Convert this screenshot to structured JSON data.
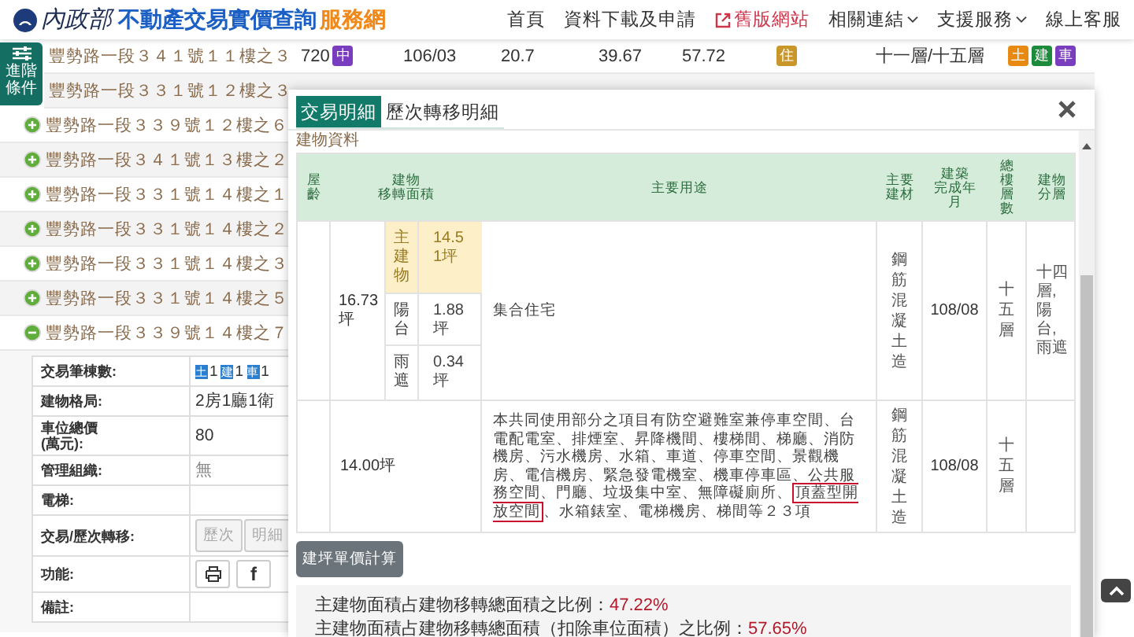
{
  "header": {
    "ministry": "內政部",
    "title": "不動產交易實價查詢",
    "title_accent": "服務網",
    "nav": [
      {
        "label": "首頁",
        "kind": "link"
      },
      {
        "label": "資料下載及申請",
        "kind": "link"
      },
      {
        "label": "舊版網站",
        "kind": "external"
      },
      {
        "label": "相關連結",
        "kind": "dropdown"
      },
      {
        "label": "支援服務",
        "kind": "dropdown"
      },
      {
        "label": "線上客服",
        "kind": "link"
      }
    ]
  },
  "filter_button": {
    "label": "進階條件"
  },
  "results": [
    {
      "address": "豐勢路一段３４１號１１樓之３",
      "cells": [
        [
          {
            "kind": "text",
            "text": "720"
          },
          {
            "kind": "badge",
            "text": "中",
            "color": "#7b3dbf"
          }
        ],
        [
          {
            "kind": "text",
            "text": "106/03"
          }
        ],
        [
          {
            "kind": "text",
            "text": "20.7"
          }
        ],
        [
          {
            "kind": "text",
            "text": "39.67"
          }
        ],
        [
          {
            "kind": "text",
            "text": "57.72"
          }
        ],
        [
          {
            "kind": "badge",
            "text": "住",
            "color": "#c9962a"
          }
        ],
        [
          {
            "kind": "text",
            "text": "十一層/十五層"
          }
        ],
        [
          {
            "kind": "badge",
            "text": "土",
            "color": "#e88a12"
          },
          {
            "kind": "badge",
            "text": "建",
            "color": "#1e8a3c"
          },
          {
            "kind": "badge",
            "text": "車",
            "color": "#7b3dbf"
          }
        ]
      ]
    },
    {
      "address": "豐勢路一段３３１號１２樓之３"
    },
    {
      "address": "豐勢路一段３３９號１２樓之６",
      "expanded": false
    },
    {
      "address": "豐勢路一段３４１號１３樓之２",
      "expanded": false
    },
    {
      "address": "豐勢路一段３３１號１４樓之１",
      "expanded": false
    },
    {
      "address": "豐勢路一段３３１號１４樓之２",
      "expanded": false
    },
    {
      "address": "豐勢路一段３３１號１４樓之３",
      "expanded": false
    },
    {
      "address": "豐勢路一段３３１號１４樓之５",
      "expanded": false
    },
    {
      "address": "豐勢路一段３３９號１４樓之７",
      "expanded": true,
      "detail": [
        {
          "label": [
            "交易筆棟數:"
          ],
          "kind": "counts",
          "counts": [
            {
              "label": "土",
              "count": "1"
            },
            {
              "label": "建",
              "count": "1"
            },
            {
              "label": "車",
              "count": "1"
            }
          ]
        },
        {
          "label": [
            "建物格局:"
          ],
          "kind": "text",
          "value": "2房1廳1衛"
        },
        {
          "label": [
            "車位總價",
            "(萬元):"
          ],
          "kind": "text",
          "value": "80"
        },
        {
          "label": [
            "管理組織:"
          ],
          "kind": "muted",
          "value": "無"
        },
        {
          "label": [
            "電梯:"
          ],
          "kind": "empty"
        },
        {
          "label": [
            "交易/歷次轉移:"
          ],
          "kind": "buttons",
          "buttons": [
            {
              "label": "歷次",
              "disabled": true
            },
            {
              "label": "明細",
              "disabled": true
            }
          ]
        },
        {
          "label": [
            "功能:"
          ],
          "kind": "icons",
          "icons": [
            {
              "kind": "print"
            },
            {
              "kind": "facebook",
              "text": "f"
            }
          ]
        },
        {
          "label": [
            "備註:"
          ],
          "kind": "empty"
        }
      ]
    }
  ],
  "modal": {
    "tabs": [
      {
        "label": "交易明細",
        "selected": true
      },
      {
        "label": "歷次轉移明細",
        "selected": false
      }
    ],
    "section_title": "建物資料",
    "columns": [
      {
        "lines": [
          "屋",
          "齡"
        ]
      },
      {
        "lines": [
          "建物",
          "移轉面積"
        ]
      },
      {
        "lines": [
          "主要用途"
        ]
      },
      {
        "lines": [
          "主要",
          "建材"
        ]
      },
      {
        "lines": [
          "建築",
          "完成年",
          "月"
        ]
      },
      {
        "lines": [
          "總",
          "樓",
          "層",
          "數"
        ]
      },
      {
        "lines": [
          "建物",
          "分層"
        ]
      }
    ],
    "rows": [
      {
        "area": "16.73坪",
        "parts": [
          {
            "label": "主建物",
            "value": "14.51坪",
            "highlight": true
          },
          {
            "label": "陽台",
            "value": "1.88坪",
            "highlight": false
          },
          {
            "label": "雨遮",
            "value": "0.34坪",
            "highlight": false
          }
        ],
        "usage": [
          {
            "text": "集合住宅",
            "boxed": false
          }
        ],
        "material": "鋼筋混凝土造",
        "completed": "108/08",
        "floors": "十五層",
        "layer": "十四層,陽台,雨遮"
      },
      {
        "area": "14.00坪",
        "usage": [
          {
            "text": "本共同使用部分之項目有防空避難室兼停車空間、台電配電室、排煙室、昇降機間、樓梯間、梯廳、消防機房、污水機房、水箱、車道、停車空間、景觀機房、電信機房、緊急發電機室、機車停車區、公共服務空間、門廳、垃圾集中室、無障礙廁所、",
            "boxed": false
          },
          {
            "text": "頂蓋型開放空間",
            "boxed": true
          },
          {
            "text": "、水箱錶室、電梯機房、梯間等２３項",
            "boxed": false
          }
        ],
        "material": "鋼筋混凝土造",
        "completed": "108/08",
        "floors": "十五層"
      }
    ],
    "calc_button": "建坪單價計算",
    "ratios": [
      {
        "label": "主建物面積占建物移轉總面積之比例：",
        "value": "47.22%"
      },
      {
        "label": "主建物面積占建物移轉總面積（扣除車位面積）之比例：",
        "value": "57.65%"
      }
    ]
  }
}
